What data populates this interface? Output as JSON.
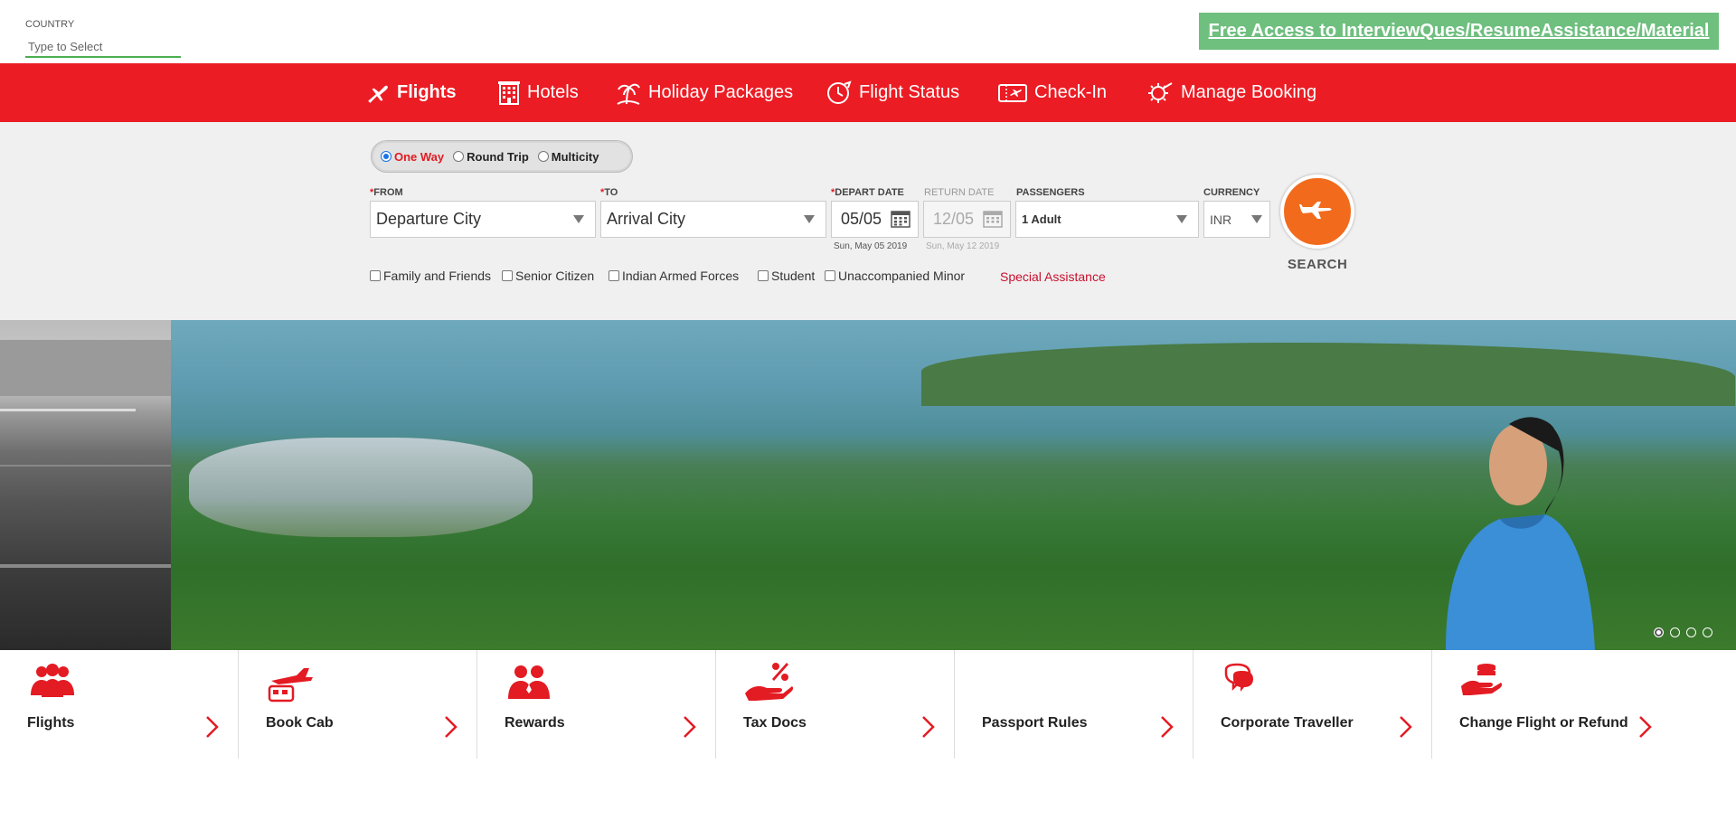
{
  "country": {
    "label": "COUNTRY",
    "placeholder": "Type to Select"
  },
  "promo": {
    "text": "Free Access to InterviewQues/ResumeAssistance/Material"
  },
  "nav": {
    "items": [
      {
        "label": "Flights",
        "icon": "plane-icon",
        "active": true
      },
      {
        "label": "Hotels",
        "icon": "hotel-icon"
      },
      {
        "label": "Holiday Packages",
        "icon": "palm-tree-icon"
      },
      {
        "label": "Flight Status",
        "icon": "flight-status-icon"
      },
      {
        "label": "Check-In",
        "icon": "ticket-icon"
      },
      {
        "label": "Manage Booking",
        "icon": "gear-plane-icon"
      }
    ]
  },
  "trip_type": {
    "options": [
      "One Way",
      "Round Trip",
      "Multicity"
    ],
    "selected": "One Way"
  },
  "form": {
    "from_label": "FROM",
    "from_value": "Departure City",
    "to_label": "TO",
    "to_value": "Arrival City",
    "depart_label": "DEPART DATE",
    "depart_value": "05/05",
    "depart_full": "Sun, May 05 2019",
    "return_label": "RETURN DATE",
    "return_value": "12/05",
    "return_full": "Sun, May 12 2019",
    "passengers_label": "PASSENGERS",
    "passengers_value": "1 Adult",
    "currency_label": "CURRENCY",
    "currency_value": "INR",
    "search_label": "SEARCH",
    "required_mark": "*"
  },
  "checkboxes": [
    "Family and Friends",
    "Senior Citizen",
    "Indian Armed Forces",
    "Student",
    "Unaccompanied Minor"
  ],
  "special_assistance": "Special Assistance",
  "carousel": {
    "slides": 4,
    "active": 0
  },
  "services": [
    {
      "label": "Flights",
      "icon": "group-icon"
    },
    {
      "label": "Book Cab",
      "icon": "cab-plane-icon"
    },
    {
      "label": "Rewards",
      "icon": "rewards-people-icon"
    },
    {
      "label": "Tax Docs",
      "icon": "percent-hand-icon"
    },
    {
      "label": "Passport Rules",
      "icon": ""
    },
    {
      "label": "Corporate Traveller",
      "icon": "chat-bubble-icon"
    },
    {
      "label": "Change Flight or Refund",
      "icon": "refund-hand-icon"
    }
  ],
  "colors": {
    "brand_red": "#ec1c24",
    "search_orange": "#f26b1d",
    "promo_green": "#6fbf7f"
  }
}
